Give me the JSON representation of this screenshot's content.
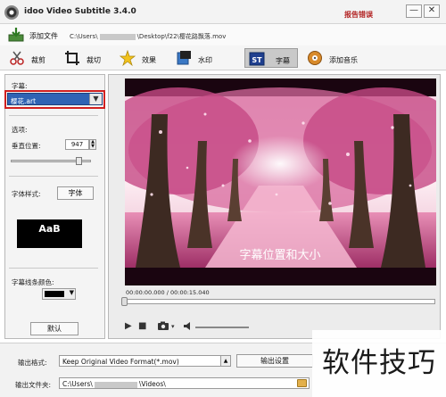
{
  "window": {
    "title": "idoo Video Subtitle 3.4.0",
    "report_link": "报告错误",
    "minimize": "—",
    "restore": "□",
    "close": "✕"
  },
  "add_bar": {
    "add_label": "添加文件",
    "path_prefix": "C:\\Users\\",
    "path_suffix": "\\Desktop\\f22\\樱花路飘落.mov"
  },
  "toolbar": {
    "items": [
      {
        "label": "裁剪",
        "icon": "scissors-icon"
      },
      {
        "label": "裁切",
        "icon": "crop-icon"
      },
      {
        "label": "效果",
        "icon": "star-icon"
      },
      {
        "label": "水印",
        "icon": "watermark-icon"
      },
      {
        "label": "字幕",
        "icon": "subtitle-icon"
      },
      {
        "label": "添加音乐",
        "icon": "music-icon"
      }
    ],
    "active": "字幕"
  },
  "left_panel": {
    "subtitle_label": "字幕:",
    "subtitle_file": "樱花.art",
    "options_label": "选项:",
    "vertical_position_label": "垂直位置:",
    "vertical_position_value": "947",
    "vertical_position_fraction": 0.85,
    "font_style_label": "字体样式:",
    "font_button": "字体",
    "font_preview": "AaB",
    "outline_color_label": "字幕线条颜色:",
    "outline_color": "#000000",
    "default_button": "默认"
  },
  "player": {
    "subtitle_text": "字幕位置和大小",
    "time_readout": "00:00:00.000 / 00:00:15.040",
    "progress": 0.0,
    "controls": [
      "play-icon",
      "stop-icon",
      "camera-icon",
      "volume-icon"
    ]
  },
  "bottom": {
    "output_format_label": "输出格式:",
    "output_format_value": "Keep Original Video Format(*.mov)",
    "output_settings_button": "输出设置",
    "output_folder_label": "输出文件夹:",
    "output_folder_prefix": "C:\\Users\\",
    "output_folder_suffix": "\\Videos\\"
  },
  "watermark": {
    "text": "软件技巧"
  }
}
